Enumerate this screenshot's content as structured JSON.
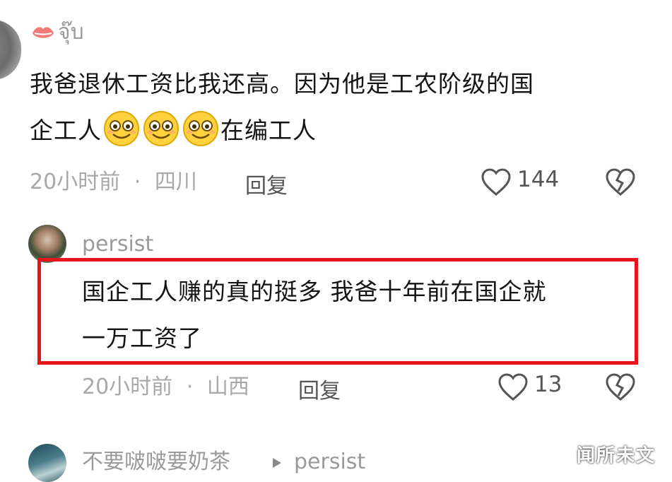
{
  "comments": [
    {
      "username": "จุ๊บ",
      "text_line1": "我爸退休工资比我还高。因为他是工农阶级的国",
      "text_line2_prefix": "企工人",
      "text_line2_suffix": "在编工人",
      "emoji_icon": "grinning-face-emoji",
      "time": "20小时前",
      "location": "四川",
      "reply_label": "回复",
      "like_count": "144"
    },
    {
      "username": "persist",
      "text_line1": "国企工人赚的真的挺多 我爸十年前在国企就",
      "text_line2": "一万工资了",
      "time": "20小时前",
      "location": "山西",
      "reply_label": "回复",
      "like_count": "13"
    },
    {
      "username": "不要啵啵要奶茶",
      "reply_to": "persist"
    }
  ],
  "separator": "·",
  "highlight_color": "#e8141b",
  "watermark": "闻所未文"
}
